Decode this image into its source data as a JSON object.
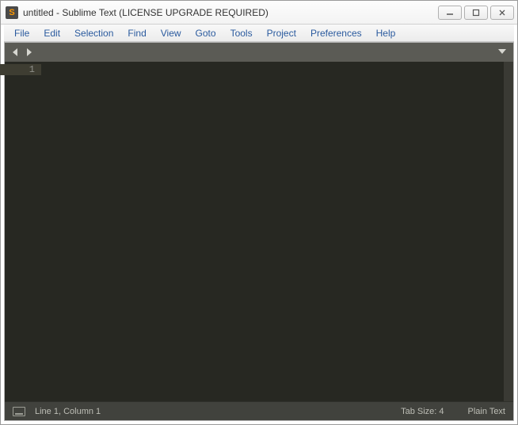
{
  "titlebar": {
    "title": "untitled - Sublime Text (LICENSE UPGRADE REQUIRED)"
  },
  "menu": {
    "items": [
      "File",
      "Edit",
      "Selection",
      "Find",
      "View",
      "Goto",
      "Tools",
      "Project",
      "Preferences",
      "Help"
    ]
  },
  "gutter": {
    "line1": "1"
  },
  "status": {
    "position": "Line 1, Column 1",
    "tabsize": "Tab Size: 4",
    "syntax": "Plain Text"
  }
}
